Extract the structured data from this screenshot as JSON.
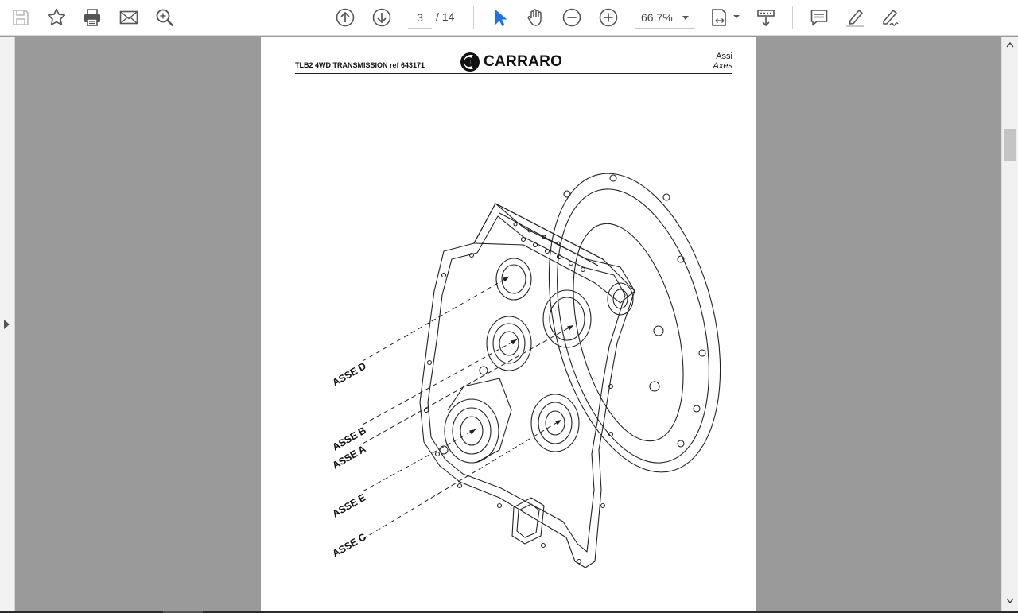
{
  "toolbar": {
    "page_current": "3",
    "page_total": "/  14",
    "zoom_value": "66.7%"
  },
  "document": {
    "title": "TLB2 4WD TRANSMISSION  ref 643171",
    "logo_text": "CARRARO",
    "header_right_1": "Assi",
    "header_right_2": "Axes"
  },
  "drawing_labels": {
    "asse_d": "ASSE D",
    "asse_b": "ASSE B",
    "asse_a": "ASSE A",
    "asse_e": "ASSE E",
    "asse_c": "ASSE C"
  }
}
